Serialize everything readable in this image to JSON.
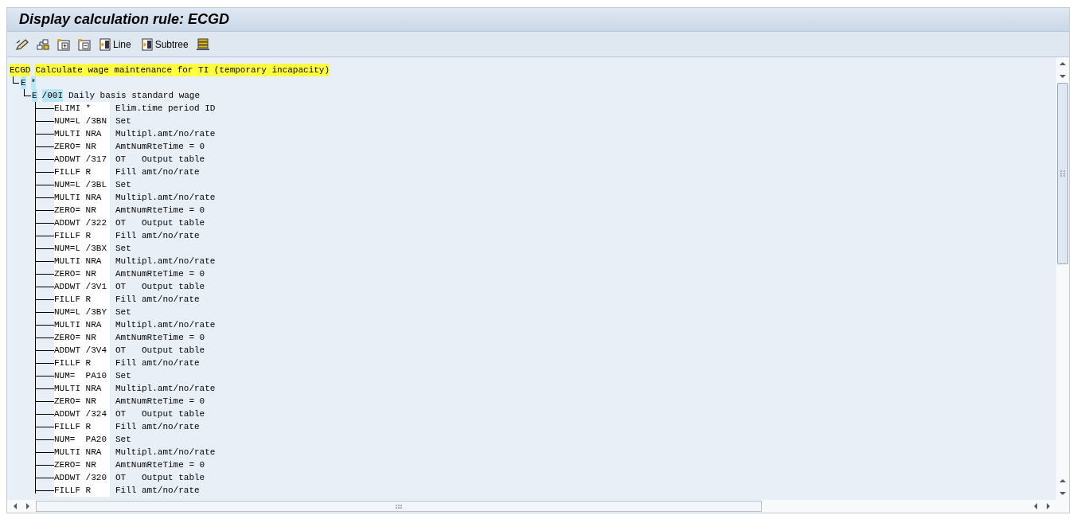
{
  "window": {
    "title": "Display calculation rule: ECGD"
  },
  "toolbar": {
    "buttons": [
      {
        "label": "Line"
      },
      {
        "label": "Subtree"
      }
    ]
  },
  "tree": {
    "code": "ECGD",
    "text": "Calculate wage maintenance for TI (temporary incapacity)",
    "children": [
      {
        "code": "E",
        "text": "*",
        "children": [
          {
            "code": "E",
            "text": "/00I",
            "description": "Daily basis standard wage",
            "children": [
              {
                "operation": "ELIMI *",
                "description": "Elim.time period ID"
              },
              {
                "operation": "NUM=L /3BN",
                "description": "Set"
              },
              {
                "operation": "MULTI NRA",
                "description": "Multipl.amt/no/rate"
              },
              {
                "operation": "ZERO= NR",
                "description": "AmtNumRteTime = 0"
              },
              {
                "operation": "ADDWT /317",
                "description": "OT   Output table"
              },
              {
                "operation": "FILLF R",
                "description": "Fill amt/no/rate"
              },
              {
                "operation": "NUM=L /3BL",
                "description": "Set"
              },
              {
                "operation": "MULTI NRA",
                "description": "Multipl.amt/no/rate"
              },
              {
                "operation": "ZERO= NR",
                "description": "AmtNumRteTime = 0"
              },
              {
                "operation": "ADDWT /322",
                "description": "OT   Output table"
              },
              {
                "operation": "FILLF R",
                "description": "Fill amt/no/rate"
              },
              {
                "operation": "NUM=L /3BX",
                "description": "Set"
              },
              {
                "operation": "MULTI NRA",
                "description": "Multipl.amt/no/rate"
              },
              {
                "operation": "ZERO= NR",
                "description": "AmtNumRteTime = 0"
              },
              {
                "operation": "ADDWT /3V1",
                "description": "OT   Output table"
              },
              {
                "operation": "FILLF R",
                "description": "Fill amt/no/rate"
              },
              {
                "operation": "NUM=L /3BY",
                "description": "Set"
              },
              {
                "operation": "MULTI NRA",
                "description": "Multipl.amt/no/rate"
              },
              {
                "operation": "ZERO= NR",
                "description": "AmtNumRteTime = 0"
              },
              {
                "operation": "ADDWT /3V4",
                "description": "OT   Output table"
              },
              {
                "operation": "FILLF R",
                "description": "Fill amt/no/rate"
              },
              {
                "operation": "NUM=  PA10",
                "description": "Set"
              },
              {
                "operation": "MULTI NRA",
                "description": "Multipl.amt/no/rate"
              },
              {
                "operation": "ZERO= NR",
                "description": "AmtNumRteTime = 0"
              },
              {
                "operation": "ADDWT /324",
                "description": "OT   Output table"
              },
              {
                "operation": "FILLF R",
                "description": "Fill amt/no/rate"
              },
              {
                "operation": "NUM=  PA20",
                "description": "Set"
              },
              {
                "operation": "MULTI NRA",
                "description": "Multipl.amt/no/rate"
              },
              {
                "operation": "ZERO= NR",
                "description": "AmtNumRteTime = 0"
              },
              {
                "operation": "ADDWT /320",
                "description": "OT   Output table"
              },
              {
                "operation": "FILLF R",
                "description": "Fill amt/no/rate"
              }
            ]
          }
        ]
      }
    ]
  }
}
